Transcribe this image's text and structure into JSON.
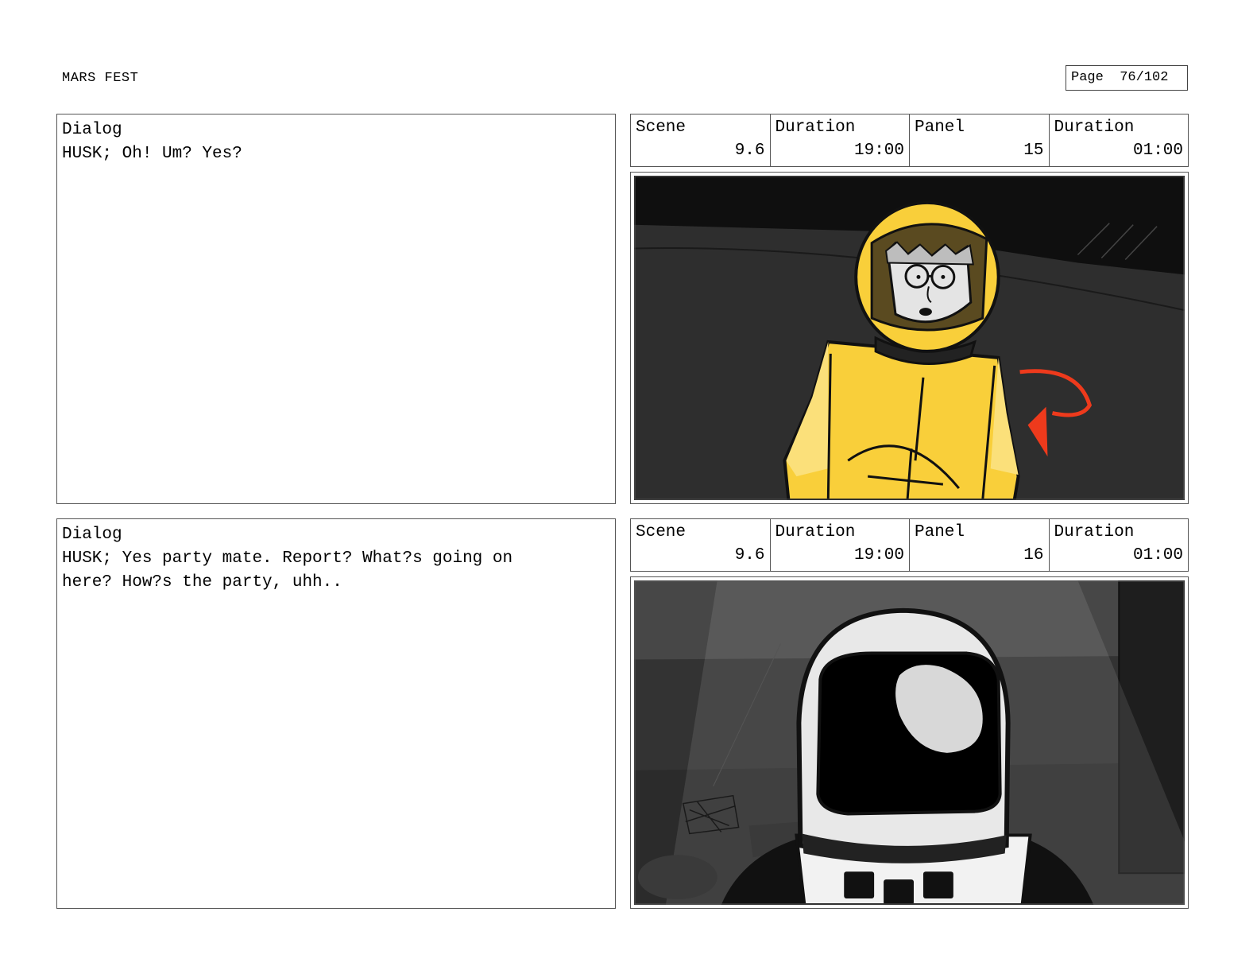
{
  "header": {
    "title": "MARS FEST",
    "page_label": "Page",
    "page_number": "76/102"
  },
  "panels": [
    {
      "dialog_label": "Dialog",
      "dialog_text": "HUSK; Oh! Um? Yes?",
      "scene_label": "Scene",
      "scene": "9.6",
      "scene_duration_label": "Duration",
      "scene_duration": "19:00",
      "panel_label": "Panel",
      "panel": "15",
      "panel_duration_label": "Duration",
      "panel_duration": "01:00"
    },
    {
      "dialog_label": "Dialog",
      "dialog_text": "HUSK; Yes party mate. Report? What?s going on\nhere? How?s the party, uhh..",
      "scene_label": "Scene",
      "scene": "9.6",
      "scene_duration_label": "Duration",
      "scene_duration": "19:00",
      "panel_label": "Panel",
      "panel": "16",
      "panel_duration_label": "Duration",
      "panel_duration": "01:00"
    }
  ],
  "colors": {
    "suit_yellow": "#f9cf3a",
    "arrow_red": "#ee3a1c",
    "bg_dark": "#2e2e2e"
  }
}
